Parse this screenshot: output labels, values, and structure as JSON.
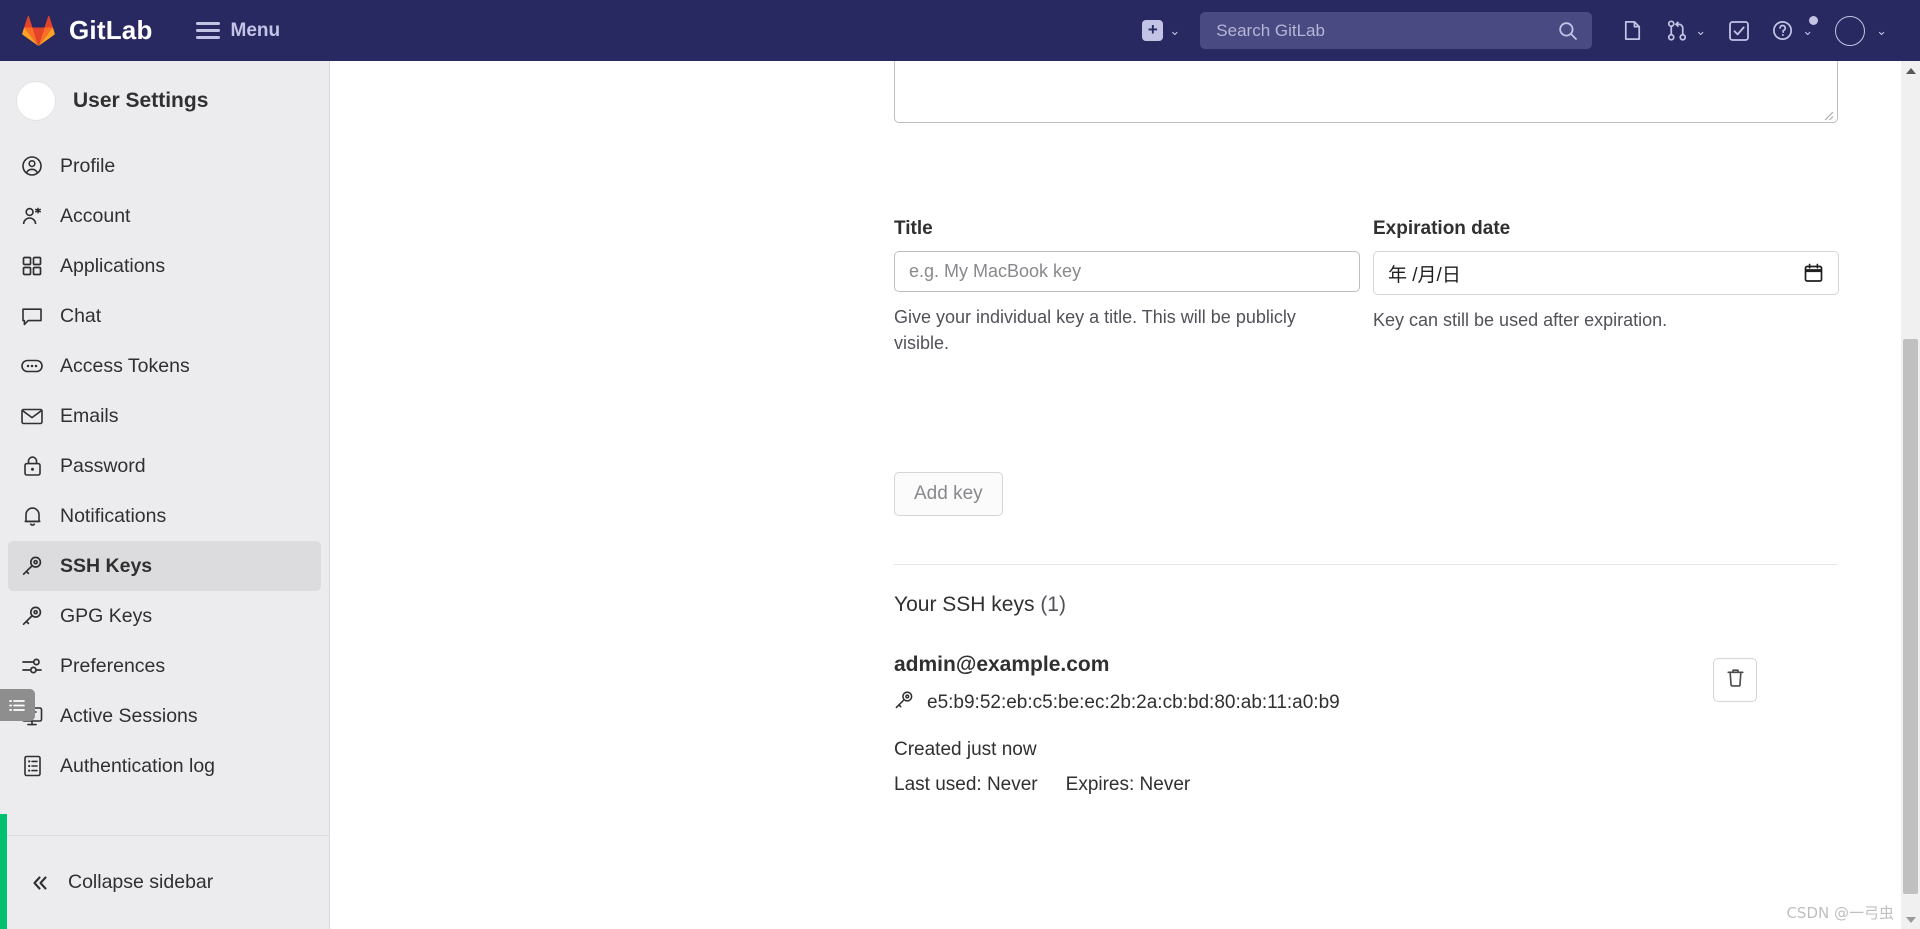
{
  "navbar": {
    "brand": "GitLab",
    "brand_logo_icon": "gitlab-tanuki-logo",
    "menu_label": "Menu",
    "menu_icon": "hamburger-icon",
    "create_new_icon": "plus-square-icon",
    "create_new_chevron": "⌄",
    "search": {
      "placeholder": "Search GitLab",
      "value": "",
      "icon": "search-icon"
    },
    "icons": [
      {
        "name": "issues-icon",
        "label": "Issues"
      },
      {
        "name": "merge-requests-icon",
        "label": "Merge requests",
        "chevron": "⌄"
      },
      {
        "name": "todos-checkbox-icon",
        "label": "To-Do List"
      },
      {
        "name": "help-question-icon",
        "label": "Help",
        "chevron": "⌄",
        "has_notification_dot": true
      },
      {
        "name": "user-avatar-icon",
        "label": "User menu",
        "chevron": "⌄"
      }
    ],
    "background_color": "#292961",
    "search_background_color": "#4a4a83",
    "text_color": "#c3c3e6"
  },
  "sidebar": {
    "title": "User Settings",
    "avatar_icon": "user-avatar-circle",
    "active_item": "SSH Keys",
    "items": [
      {
        "label": "Profile",
        "icon": "profile-user-icon"
      },
      {
        "label": "Account",
        "icon": "account-gear-user-icon"
      },
      {
        "label": "Applications",
        "icon": "applications-grid-icon"
      },
      {
        "label": "Chat",
        "icon": "chat-bubble-icon"
      },
      {
        "label": "Access Tokens",
        "icon": "access-token-ellipsis-icon"
      },
      {
        "label": "Emails",
        "icon": "email-envelope-icon"
      },
      {
        "label": "Password",
        "icon": "password-lock-icon"
      },
      {
        "label": "Notifications",
        "icon": "notification-bell-icon"
      },
      {
        "label": "SSH Keys",
        "icon": "ssh-key-icon"
      },
      {
        "label": "GPG Keys",
        "icon": "gpg-key-icon"
      },
      {
        "label": "Preferences",
        "icon": "preferences-sliders-icon"
      },
      {
        "label": "Active Sessions",
        "icon": "active-sessions-monitor-icon"
      },
      {
        "label": "Authentication log",
        "icon": "authentication-log-icon"
      }
    ],
    "collapse_label": "Collapse sidebar",
    "collapse_icon": "double-chevron-left-icon",
    "accent_color": "#00c26e",
    "background_color": "#ececef",
    "active_background_color": "#dcdcde",
    "floating_tab_icon": "list-panel-handle-icon"
  },
  "main": {
    "key_textarea": {
      "value": "",
      "placeholder": ""
    },
    "title_field": {
      "label": "Title",
      "value": "",
      "placeholder": "e.g. My MacBook key",
      "hint": "Give your individual key a title. This will be publicly visible."
    },
    "expiration_field": {
      "label": "Expiration date",
      "value": "年 /月/日",
      "hint": "Key can still be used after expiration.",
      "calendar_icon": "calendar-icon"
    },
    "add_key_button": "Add key",
    "keys_section": {
      "heading": "Your SSH keys",
      "count": "(1)",
      "keys": [
        {
          "title": "admin@example.com",
          "fingerprint": "e5:b9:52:eb:c5:be:ec:2b:2a:cb:bd:80:ab:11:a0:b9",
          "fingerprint_icon": "ssh-key-icon",
          "created": "Created just now",
          "last_used": "Last used: Never",
          "expires": "Expires: Never",
          "delete_icon": "trash-delete-icon"
        }
      ]
    }
  },
  "scrollbar": {
    "up_arrow_icon": "scroll-arrow-up-icon",
    "down_arrow_icon": "scroll-arrow-down-icon",
    "thumb_icon": "scrollbar-thumb"
  },
  "watermark": "CSDN @一弓虫"
}
